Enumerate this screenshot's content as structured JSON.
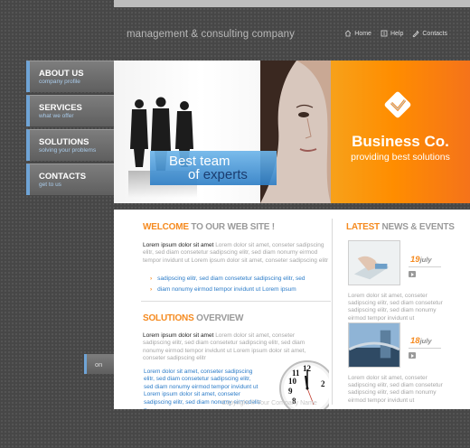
{
  "header": {
    "tagline": "management & consulting company",
    "nav": [
      {
        "label": "Home",
        "icon": "home-icon"
      },
      {
        "label": "Help",
        "icon": "help-icon"
      },
      {
        "label": "Contacts",
        "icon": "contacts-icon"
      }
    ]
  },
  "sidebar": {
    "items": [
      {
        "title": "ABOUT US",
        "subtitle": "company profile"
      },
      {
        "title": "SERVICES",
        "subtitle": "what we offer"
      },
      {
        "title": "SOLUTIONS",
        "subtitle": "solving your problems"
      },
      {
        "title": "CONTACTS",
        "subtitle": "get to us"
      }
    ],
    "small_tab": "on"
  },
  "hero": {
    "banner_line1": "Best team",
    "banner_line2_prefix": "of ",
    "banner_line2_emph": "experts",
    "brand_title": "Business Co.",
    "brand_subtitle": "providing best solutions"
  },
  "welcome": {
    "title_highlight": "WELCOME",
    "title_rest": " TO OUR WEB SITE !",
    "lead": "Lorem ipsum dolor sit amet",
    "text": " Lorem dolor sit amet, conseter sadipscing elitr, sed diam consetetur sadipscing elitr, sed diam nonumy eirmod tempor invidunt ut Lorem ipsum dolor sit amet, conseter sadipscing elitr",
    "bullets": [
      "sadipscing elitr, sed diam consetetur sadipscing elitr, sed",
      "diam nonumy eirmod tempor invidunt ut Lorem ipsum"
    ]
  },
  "solutions": {
    "title_highlight": "SOLUTIONS",
    "title_rest": " OVERVIEW",
    "lead": "Lorem ipsum dolor sit amet",
    "text": " Lorem dolor sit amet, conseter sadipscing elitr, sed diam consetetur sadipscing elitr, sed diam nonumy eirmod tempor invidunt ut Lorem ipsum dolor sit amet, conseter sadipscing elitr",
    "link_text": "Lorem dolor sit amet, conseter sadipscing elitr, sed diam consetetur sadipscing elitr, sed diam nonumy eirmod tempor invidunt ut Lorem ipsum dolor sit amet, conseter sadipscing elitr, sed diam nonumy eirmodelitr »"
  },
  "news": {
    "title_highlight": "LATEST",
    "title_rest": " NEWS & EVENTS",
    "items": [
      {
        "day": "19",
        "month": "july",
        "text": "Lorem dolor sit amet, conseter sadipscing elitr, sed diam consetetur sadipscing elitr, sed diam nonumy eirmod tempor invidunt ut"
      },
      {
        "day": "18",
        "month": "july",
        "text": "Lorem dolor sit amet, conseter sadipscing elitr, sed diam consetetur sadipscing elitr, sed diam nonumy eirmod tempor invidunt ut"
      }
    ]
  },
  "footer": {
    "copyright": "Copyright © Your Company Name"
  },
  "colors": {
    "accent_orange": "#f58a1f",
    "accent_blue": "#2a7bc8",
    "background": "#474747"
  }
}
